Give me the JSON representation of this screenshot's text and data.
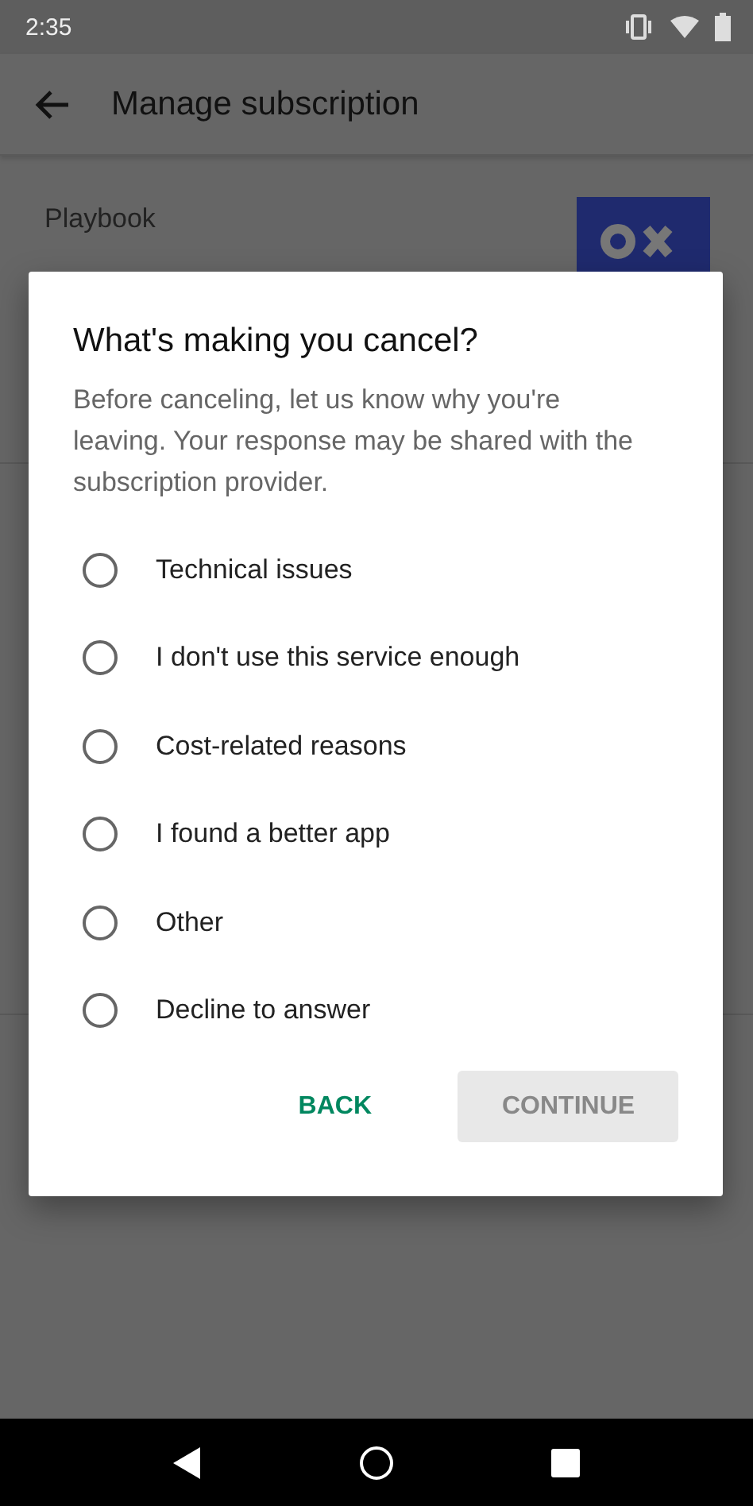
{
  "status_bar": {
    "time": "2:35"
  },
  "app_bar": {
    "title": "Manage subscription"
  },
  "subscription": {
    "name": "Playbook"
  },
  "dialog": {
    "title": "What's making you cancel?",
    "message": "Before canceling, let us know why you're leaving. Your response may be shared with the subscription provider.",
    "options": [
      {
        "label": "Technical issues",
        "selected": false
      },
      {
        "label": "I don't use this service enough",
        "selected": false
      },
      {
        "label": "Cost-related reasons",
        "selected": false
      },
      {
        "label": "I found a better app",
        "selected": false
      },
      {
        "label": "Other",
        "selected": false
      },
      {
        "label": "Decline to answer",
        "selected": false
      }
    ],
    "buttons": [
      {
        "label": "BACK",
        "kind": "text",
        "disabled": false
      },
      {
        "label": "CONTINUE",
        "kind": "filled",
        "disabled": true
      }
    ]
  }
}
